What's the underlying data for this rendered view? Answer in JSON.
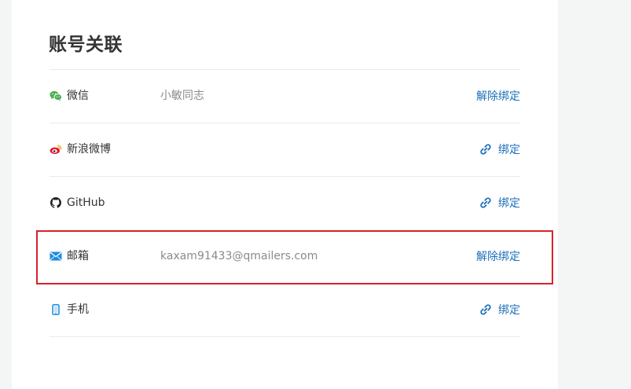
{
  "section": {
    "title": "账号关联"
  },
  "accounts": [
    {
      "icon": "wechat-icon",
      "name": "微信",
      "value": "小敏同志",
      "action": "解除绑定",
      "action_type": "unbind"
    },
    {
      "icon": "weibo-icon",
      "name": "新浪微博",
      "value": "",
      "action": "绑定",
      "action_type": "bind"
    },
    {
      "icon": "github-icon",
      "name": "GitHub",
      "value": "",
      "action": "绑定",
      "action_type": "bind"
    },
    {
      "icon": "mail-icon",
      "name": "邮箱",
      "value": "kaxam91433@qmailers.com",
      "action": "解除绑定",
      "action_type": "unbind"
    },
    {
      "icon": "phone-icon",
      "name": "手机",
      "value": "",
      "action": "绑定",
      "action_type": "bind"
    }
  ],
  "colors": {
    "link": "#1a6fb9",
    "highlight_border": "#d9222a",
    "wechat": "#4caf50",
    "weibo": "#e6162d",
    "mail": "#1a8ce0",
    "phone": "#1a8ce0"
  },
  "highlighted_row": "mail-row"
}
